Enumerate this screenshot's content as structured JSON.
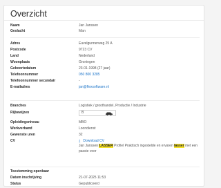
{
  "header": {
    "title": "Overzicht"
  },
  "fields": {
    "naam": {
      "label": "Naam",
      "value": "Jan Janssen"
    },
    "geslacht": {
      "label": "Geslacht",
      "value": "Man"
    },
    "adres": {
      "label": "Adres",
      "value": "Euvelgunnerweg 25 A"
    },
    "postcode": {
      "label": "Postcode",
      "value": "9723 CV"
    },
    "land": {
      "label": "Land",
      "value": "Nederland"
    },
    "woonplaats": {
      "label": "Woonplaats",
      "value": "Groningen"
    },
    "geboortedatum": {
      "label": "Geboortedatum",
      "value": "23-01-1998 (27 jaar)"
    },
    "telefoon": {
      "label": "Telefoonnummer",
      "value": "050 800 3285"
    },
    "telefoon2": {
      "label": "Telefoonnummer secundair",
      "value": "-"
    },
    "email": {
      "label": "E-mailadres",
      "value": "jan@flexsoftware.nl"
    },
    "branches": {
      "label": "Branches",
      "value": "Logistiek / groothandel, Productie / Industrie"
    },
    "rijbewijzen": {
      "label": "Rijbewijzen",
      "value": "B"
    },
    "opleidingsniveau": {
      "label": "Opleidingsniveau",
      "value": "MBO"
    },
    "werkverband": {
      "label": "Werkverband",
      "value": "Loondienst"
    },
    "gewenste_uren": {
      "label": "Gewenste uren",
      "value": "32"
    },
    "cv": {
      "label": "CV",
      "download_label": "Download CV",
      "text_part1": "Jan Janssen ",
      "highlight1": "LASSER",
      "text_part2": " Profiel Praktisch ingestelde en ervaren ",
      "highlight2": "lasser",
      "text_part3": " met een passie voor"
    },
    "toestemming": {
      "label": "Toestemming openbaar",
      "value": ""
    },
    "datum": {
      "label": "Datum inschrijving",
      "value": "21-07-2025 11:53"
    },
    "status": {
      "label": "Status",
      "value": "Gepubliceerd"
    }
  },
  "icons": {
    "license": "car-icon",
    "download": "download-icon"
  },
  "colors": {
    "link": "#1a73c8",
    "highlight": "#f5e12a"
  }
}
